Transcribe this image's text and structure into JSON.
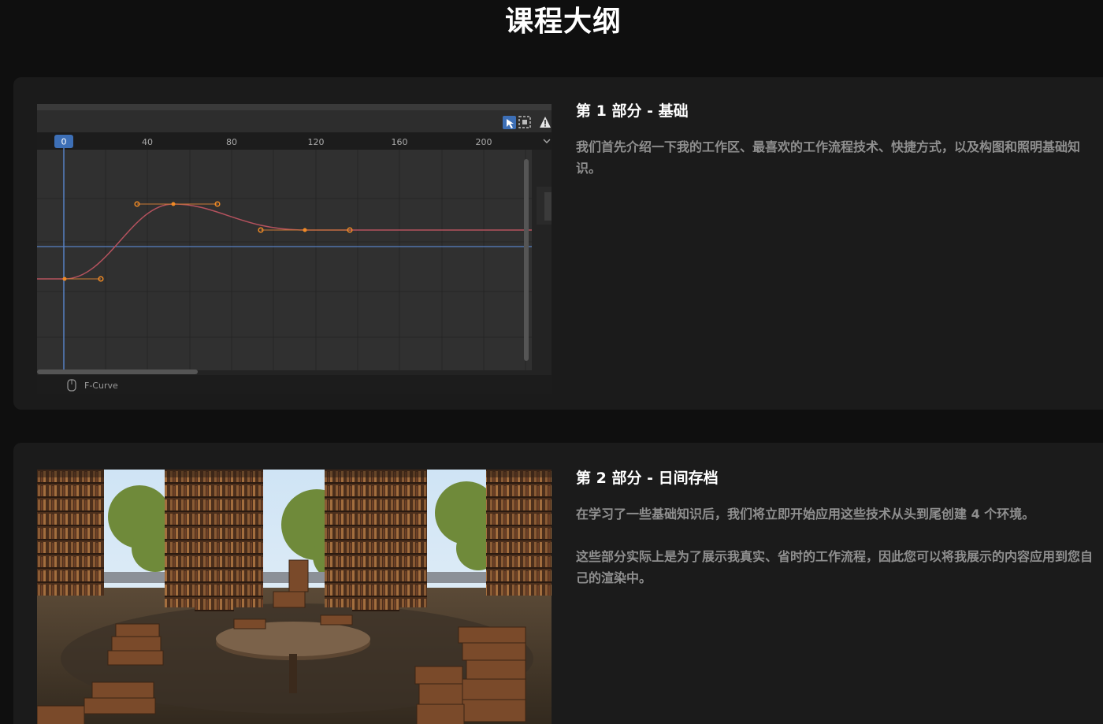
{
  "page": {
    "title": "课程大纲"
  },
  "sections": [
    {
      "title": "第 1 部分 - 基础",
      "paragraphs": [
        "我们首先介绍一下我的工作区、最喜欢的工作流程技术、快捷方式，以及构图和照明基础知识。"
      ],
      "editor": {
        "frame_current": "0",
        "ruler_labels": [
          "40",
          "80",
          "120",
          "160",
          "200"
        ],
        "footer_label": "F-Curve",
        "curve_color": "#b5525e",
        "key_color": "#f08a24",
        "cursor_color": "#5680c2",
        "frame_badge_color": "#3d6fb6"
      }
    },
    {
      "title": "第 2 部分 - 日间存档",
      "paragraphs": [
        "在学习了一些基础知识后，我们将立即开始应用这些技术从头到尾创建 4 个环境。",
        "这些部分实际上是为了展示我真实、省时的工作流程，因此您可以将我展示的内容应用到您自己的渲染中。"
      ]
    }
  ]
}
